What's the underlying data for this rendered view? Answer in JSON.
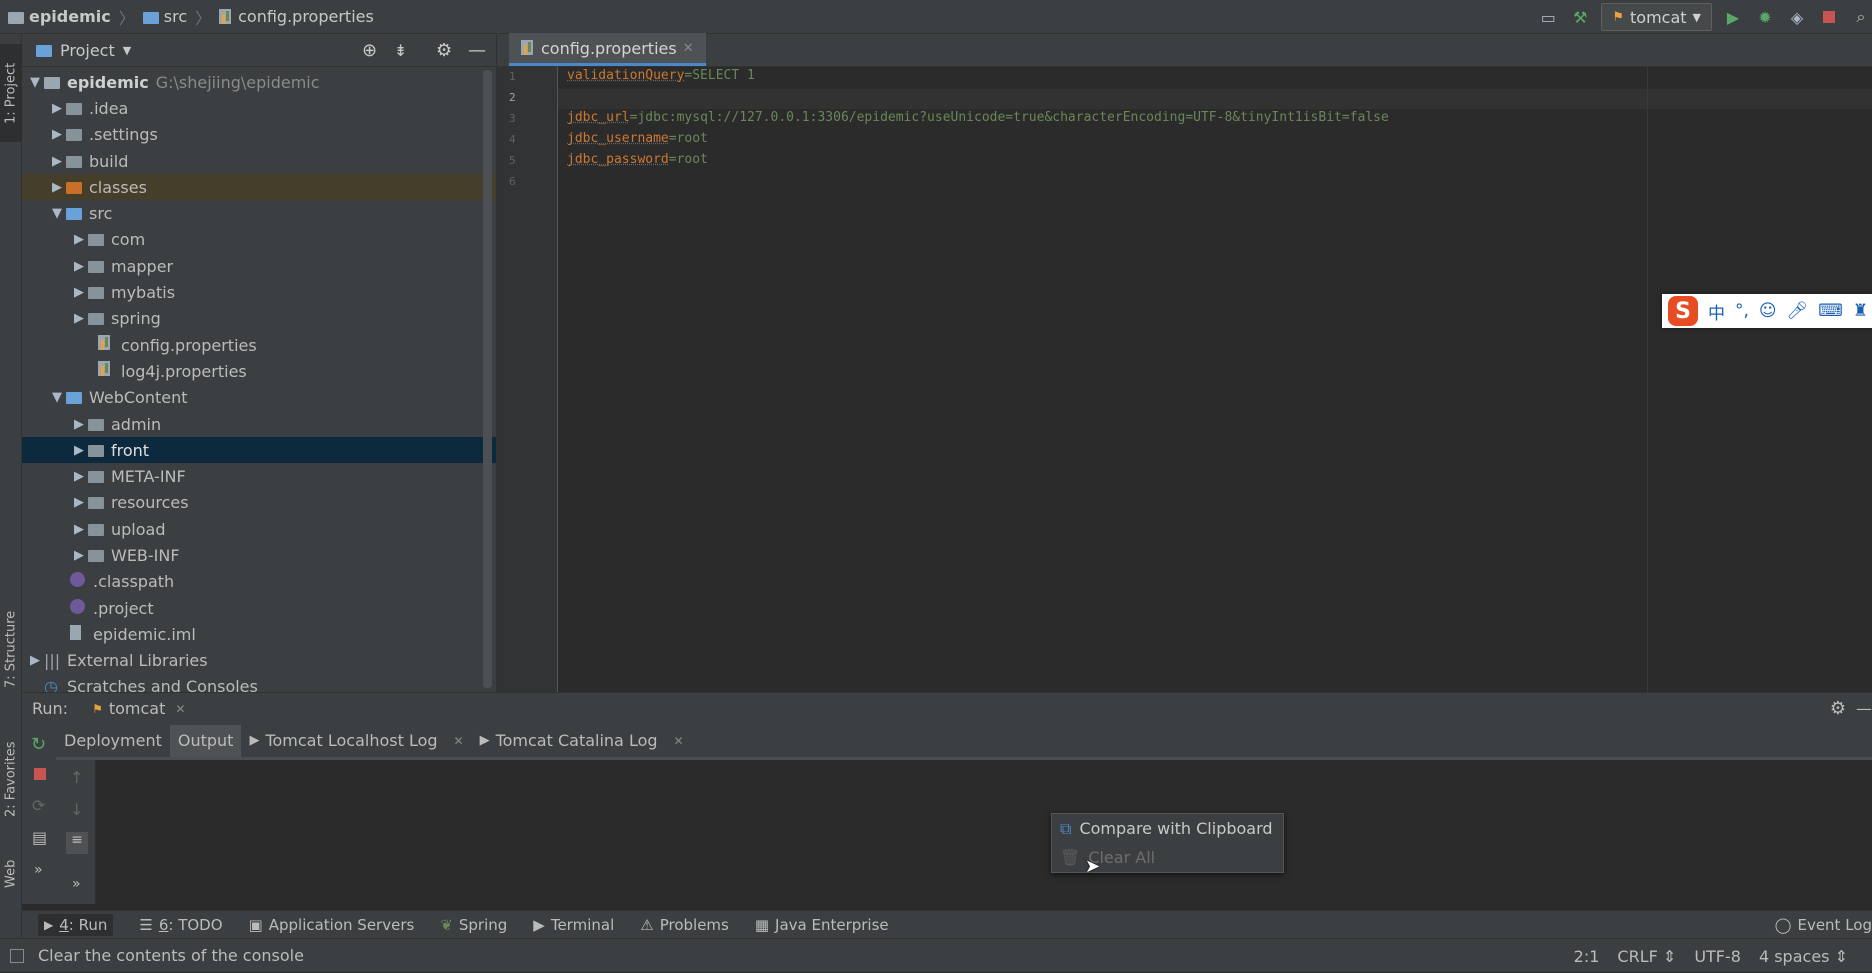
{
  "navbar": {
    "crumbs": [
      "epidemic",
      "src",
      "config.properties"
    ],
    "run_config": "tomcat"
  },
  "sidebar_tabs": {
    "project": "1: Project",
    "structure": "7: Structure",
    "favorites": "2: Favorites",
    "web": "Web"
  },
  "project_panel": {
    "title": "Project",
    "tree": [
      {
        "label": "epidemic",
        "extra": "G:\\shejiing\\epidemic"
      },
      {
        "label": ".idea"
      },
      {
        "label": ".settings"
      },
      {
        "label": "build"
      },
      {
        "label": "classes"
      },
      {
        "label": "src"
      },
      {
        "label": "com"
      },
      {
        "label": "mapper"
      },
      {
        "label": "mybatis"
      },
      {
        "label": "spring"
      },
      {
        "label": "config.properties"
      },
      {
        "label": "log4j.properties"
      },
      {
        "label": "WebContent"
      },
      {
        "label": "admin"
      },
      {
        "label": "front"
      },
      {
        "label": "META-INF"
      },
      {
        "label": "resources"
      },
      {
        "label": "upload"
      },
      {
        "label": "WEB-INF"
      },
      {
        "label": ".classpath"
      },
      {
        "label": ".project"
      },
      {
        "label": "epidemic.iml"
      },
      {
        "label": "External Libraries"
      },
      {
        "label": "Scratches and Consoles"
      }
    ]
  },
  "editor": {
    "tab": "config.properties",
    "line_numbers": [
      "1",
      "2",
      "3",
      "4",
      "5",
      "6"
    ],
    "lines": [
      {
        "key": "validationQuery",
        "value": "=SELECT 1"
      },
      {
        "key": "",
        "value": ""
      },
      {
        "key": "jdbc_url",
        "value": "=jdbc:mysql://127.0.0.1:3306/epidemic?useUnicode=true&characterEncoding=UTF-8&tinyInt1isBit=false"
      },
      {
        "key": "jdbc_username",
        "value": "=root"
      },
      {
        "key": "jdbc_password",
        "value": "=root"
      },
      {
        "key": "",
        "value": ""
      }
    ]
  },
  "ime_toolbar": {
    "logo": "S",
    "mode": "中",
    "punct": "°,"
  },
  "run_panel": {
    "label": "Run:",
    "config_tab": "tomcat",
    "tabs": [
      "Deployment",
      "Output",
      "Tomcat Localhost Log",
      "Tomcat Catalina Log"
    ]
  },
  "context_menu": {
    "items": [
      {
        "label": "Compare with Clipboard",
        "enabled": true
      },
      {
        "label": "Clear All",
        "enabled": false
      }
    ]
  },
  "bottom_tools": [
    {
      "num": "4",
      "label": ": Run"
    },
    {
      "num": "6",
      "label": ": TODO"
    },
    {
      "num": "",
      "label": "Application Servers"
    },
    {
      "num": "",
      "label": "Spring"
    },
    {
      "num": "",
      "label": "Terminal"
    },
    {
      "num": "",
      "label": "Problems"
    },
    {
      "num": "",
      "label": "Java Enterprise"
    },
    {
      "num": "",
      "label": "Event Log"
    }
  ],
  "status_bar": {
    "message": "Clear the contents of the console",
    "position": "2:1",
    "line_sep": "CRLF",
    "encoding": "UTF-8",
    "indent": "4 spaces"
  }
}
